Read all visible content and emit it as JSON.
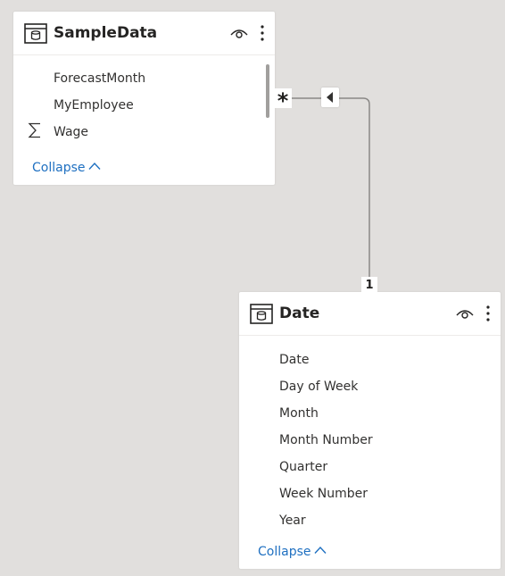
{
  "relationship": {
    "many_label": "*",
    "one_label": "1",
    "filter_direction": "single"
  },
  "tables": {
    "sample": {
      "title": "SampleData",
      "fields": [
        "ForecastMonth",
        "MyEmployee",
        "Wage"
      ],
      "sum_field": "Wage",
      "collapse_label": "Collapse"
    },
    "date": {
      "title": "Date",
      "fields": [
        "Date",
        "Day of Week",
        "Month",
        "Month Number",
        "Quarter",
        "Week Number",
        "Year"
      ],
      "collapse_label": "Collapse"
    }
  },
  "icons": {
    "table": "table-icon",
    "visibility": "eye-icon",
    "more": "more-options-icon",
    "sum": "sigma-icon",
    "collapse": "chevron-up-icon",
    "filter": "filter-direction-arrow-icon"
  },
  "colors": {
    "canvas": "#e1dfdd",
    "card": "#ffffff",
    "text": "#323130",
    "link": "#1f70c1",
    "line": "#8a8886"
  }
}
